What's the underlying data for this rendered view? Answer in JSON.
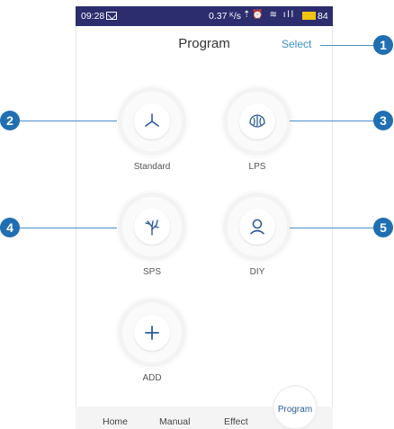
{
  "status_bar": {
    "time": "09:28",
    "network": "0.37 ᴷ/s",
    "icons": "⇡⏰ ≋ ıll",
    "battery": "84"
  },
  "header": {
    "title": "Program",
    "select_label": "Select"
  },
  "programs": [
    {
      "label": "Standard",
      "icon": "fan-icon"
    },
    {
      "label": "LPS",
      "icon": "coral-brain-icon"
    },
    {
      "label": "SPS",
      "icon": "coral-branch-icon"
    },
    {
      "label": "DIY",
      "icon": "user-icon"
    },
    {
      "label": "ADD",
      "icon": "plus-icon"
    }
  ],
  "callouts": [
    "1",
    "2",
    "3",
    "4",
    "5"
  ],
  "tabs": {
    "home": "Home",
    "manual": "Manual",
    "effect": "Effect",
    "program": "Program"
  },
  "colors": {
    "status_bar": "#2b2d6e",
    "accent": "#3a8fc7",
    "callout": "#1f6fb2"
  }
}
